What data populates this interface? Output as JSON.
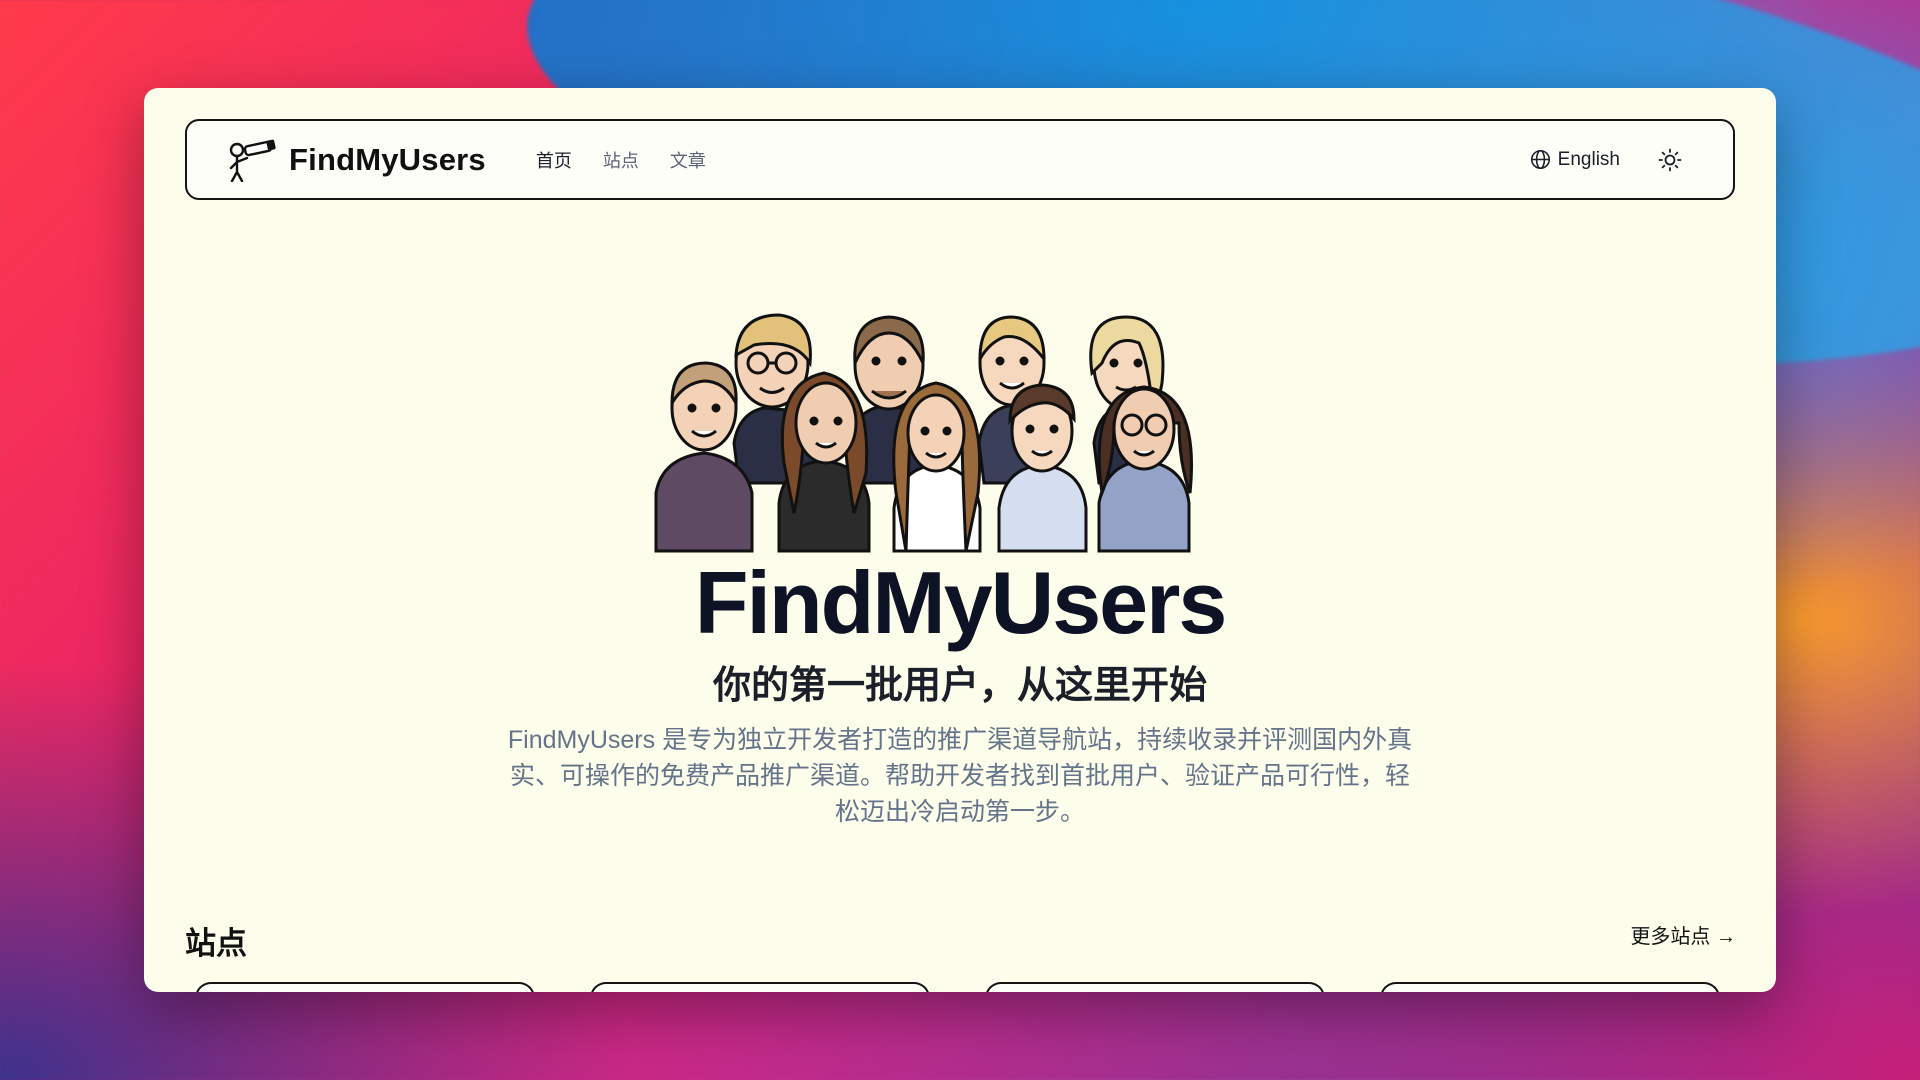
{
  "navbar": {
    "brand_name": "FindMyUsers",
    "links": [
      {
        "label": "首页",
        "active": true
      },
      {
        "label": "站点",
        "active": false
      },
      {
        "label": "文章",
        "active": false
      }
    ],
    "language_label": "English",
    "icons": {
      "brand": "telescope-person-icon",
      "language": "globe-icon",
      "theme": "sun-icon"
    }
  },
  "hero": {
    "title": "FindMyUsers",
    "subtitle": "你的第一批用户，从这里开始",
    "description": "FindMyUsers 是专为独立开发者打造的推广渠道导航站，持续收录并评测国内外真实、可操作的免费产品推广渠道。帮助开发者找到首批用户、验证产品可行性，轻松迈出冷启动第一步。"
  },
  "sites_section": {
    "title": "站点",
    "more_label": "更多站点 →"
  },
  "colors": {
    "window_bg": "#fdfdeb",
    "text_dark": "#0d1324",
    "text_muted": "#64748b",
    "border": "#141414"
  }
}
